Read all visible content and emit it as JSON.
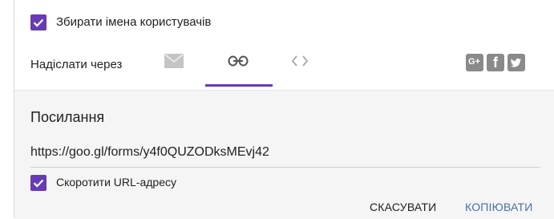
{
  "collect_names": {
    "label": "Збирати імена користувачів",
    "checked": true
  },
  "send_via": {
    "label": "Надіслати через",
    "tabs": [
      {
        "icon": "email-icon",
        "selected": false
      },
      {
        "icon": "link-icon",
        "selected": true
      },
      {
        "icon": "embed-code-icon",
        "selected": false
      }
    ],
    "share": [
      {
        "icon": "google-plus-icon",
        "text": "G+"
      },
      {
        "icon": "facebook-icon",
        "text": "f"
      },
      {
        "icon": "twitter-icon"
      }
    ]
  },
  "link_panel": {
    "heading": "Посилання",
    "url": "https://goo.gl/forms/y4f0QUZODksMEvj42",
    "shorten": {
      "label": "Скоротити URL-адресу",
      "checked": true
    }
  },
  "actions": {
    "cancel": "СКАСУВАТИ",
    "copy": "КОПІЮВАТИ"
  },
  "colors": {
    "accent": "#673ab7",
    "link_button": "#4a6fa8",
    "panel_bg": "#f5f5f5"
  }
}
